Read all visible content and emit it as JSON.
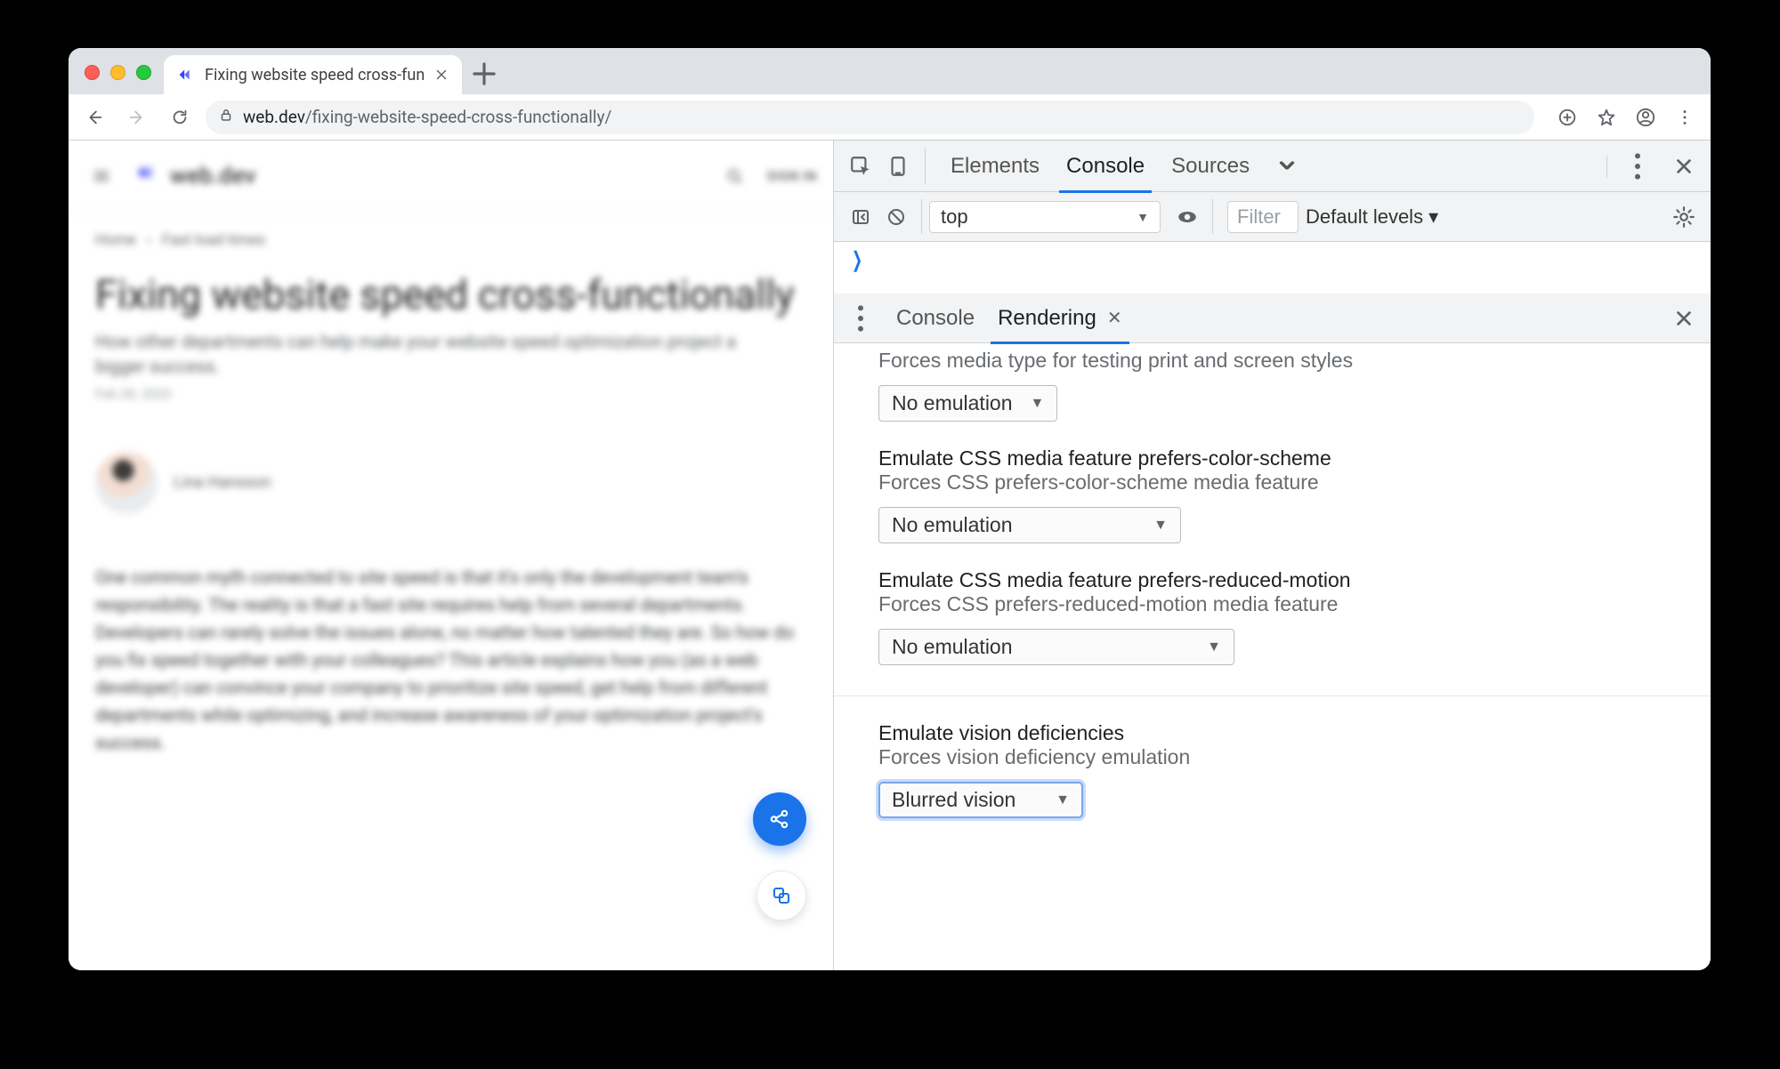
{
  "browser": {
    "tab_title": "Fixing website speed cross-fun",
    "url_host": "web.dev",
    "url_path": "/fixing-website-speed-cross-functionally/",
    "new_tab_tooltip": "+"
  },
  "page": {
    "brand": "web.dev",
    "signin": "SIGN IN",
    "breadcrumb_home": "Home",
    "breadcrumb_section": "Fast load times",
    "title": "Fixing website speed cross-functionally",
    "subtitle": "How other departments can help make your website speed optimization project a bigger success.",
    "date": "Feb 28, 2020",
    "author": "Lina Hansson",
    "body": "One common myth connected to site speed is that it's only the development team's responsibility. The reality is that a fast site requires help from several departments. Developers can rarely solve the issues alone, no matter how talented they are. So how do you fix speed together with your colleagues? This article explains how you (as a web developer) can convince your company to prioritize site speed, get help from different departments while optimizing, and increase awareness of your optimization project's success."
  },
  "devtools": {
    "tabs": {
      "elements": "Elements",
      "console": "Console",
      "sources": "Sources"
    },
    "context": "top",
    "filter_placeholder": "Filter",
    "levels": "Default levels ▾",
    "drawer": {
      "console_tab": "Console",
      "rendering_tab": "Rendering"
    },
    "rendering": {
      "media_type": {
        "desc": "Forces media type for testing print and screen styles",
        "value": "No emulation"
      },
      "color_scheme": {
        "title": "Emulate CSS media feature prefers-color-scheme",
        "desc": "Forces CSS prefers-color-scheme media feature",
        "value": "No emulation"
      },
      "reduced_motion": {
        "title": "Emulate CSS media feature prefers-reduced-motion",
        "desc": "Forces CSS prefers-reduced-motion media feature",
        "value": "No emulation"
      },
      "vision": {
        "title": "Emulate vision deficiencies",
        "desc": "Forces vision deficiency emulation",
        "value": "Blurred vision"
      }
    }
  }
}
